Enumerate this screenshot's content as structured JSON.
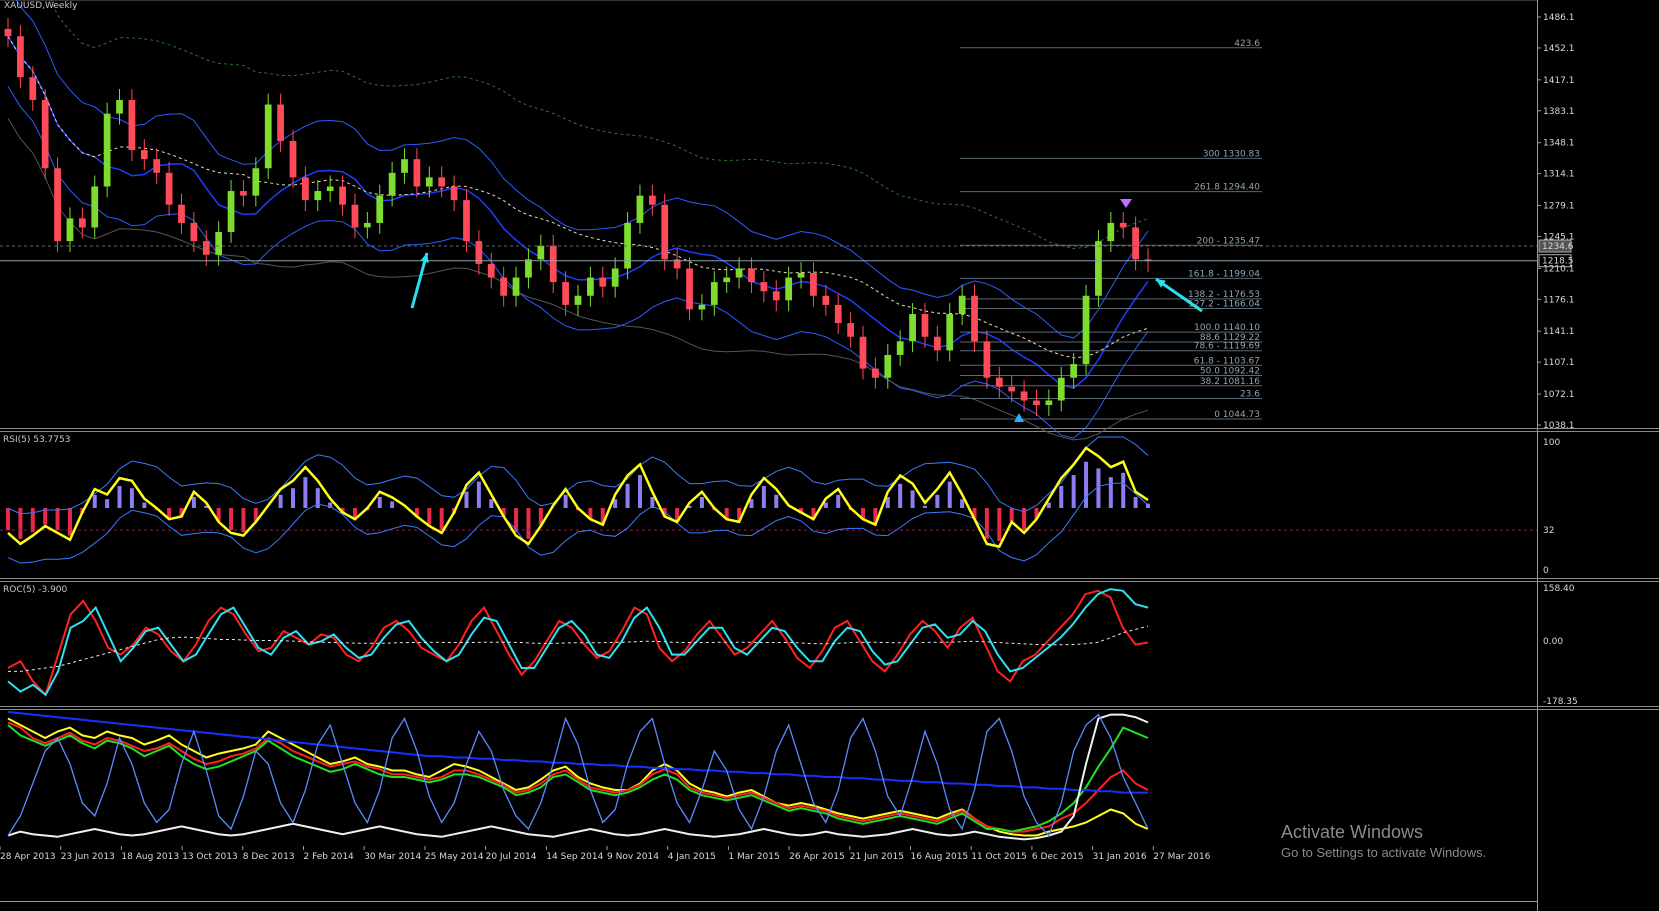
{
  "chart_data": [
    {
      "type": "candlestick",
      "title": "XAUUSD,Weekly",
      "y_ticks": [
        1486.1,
        1452.1,
        1417.1,
        1383.1,
        1348.1,
        1314.1,
        1279.1,
        1245.1,
        1210.1,
        1176.1,
        1141.1,
        1107.1,
        1072.1,
        1038.1
      ],
      "ylim": [
        1038.1,
        1486.1
      ],
      "price_tags": [
        1234.6,
        1218.5
      ],
      "x_labels": [
        "28 Apr 2013",
        "23 Jun 2013",
        "18 Aug 2013",
        "13 Oct 2013",
        "8 Dec 2013",
        "2 Feb 2014",
        "30 Mar 2014",
        "25 May 2014",
        "20 Jul 2014",
        "14 Sep 2014",
        "9 Nov 2014",
        "4 Jan 2015",
        "1 Mar 2015",
        "26 Apr 2015",
        "21 Jun 2015",
        "16 Aug 2015",
        "11 Oct 2015",
        "6 Dec 2015",
        "31 Jan 2016",
        "27 Mar 2016"
      ],
      "close_approx": [
        1465,
        1420,
        1395,
        1320,
        1240,
        1265,
        1255,
        1300,
        1380,
        1395,
        1340,
        1330,
        1315,
        1280,
        1260,
        1240,
        1225,
        1250,
        1295,
        1290,
        1320,
        1390,
        1350,
        1310,
        1285,
        1295,
        1300,
        1280,
        1255,
        1260,
        1290,
        1315,
        1330,
        1300,
        1310,
        1300,
        1285,
        1240,
        1215,
        1200,
        1180,
        1200,
        1220,
        1235,
        1195,
        1170,
        1180,
        1200,
        1190,
        1210,
        1260,
        1290,
        1280,
        1220,
        1210,
        1165,
        1170,
        1195,
        1200,
        1210,
        1195,
        1185,
        1175,
        1200,
        1205,
        1180,
        1170,
        1150,
        1135,
        1100,
        1090,
        1115,
        1130,
        1160,
        1135,
        1120,
        1160,
        1180,
        1130,
        1090,
        1080,
        1075,
        1065,
        1060,
        1065,
        1090,
        1105,
        1180,
        1240,
        1260,
        1255,
        1220,
        1218
      ],
      "fibonacci": [
        {
          "label": "423.6",
          "price": 1452.3
        },
        {
          "label": "300 1330.83",
          "price": 1330.83
        },
        {
          "label": "261.8 1294.40",
          "price": 1294.4
        },
        {
          "label": "200 - 1235.47",
          "price": 1235.47
        },
        {
          "label": "161.8 - 1199.04",
          "price": 1199.04
        },
        {
          "label": "138.2 - 1176.53",
          "price": 1176.53
        },
        {
          "label": "127.2 - 1166.04",
          "price": 1166.04
        },
        {
          "label": "100.0 1140.10",
          "price": 1140.1
        },
        {
          "label": "88.6 1129.22",
          "price": 1129.22
        },
        {
          "label": "78.6 - 1119.69",
          "price": 1119.69
        },
        {
          "label": "61.8 - 1103.67",
          "price": 1103.67
        },
        {
          "label": "50.0 1092.42",
          "price": 1092.42
        },
        {
          "label": "38.2 1081.16",
          "price": 1081.16
        },
        {
          "label": "23.6",
          "price": 1067.2
        },
        {
          "label": "0 1044.73",
          "price": 1044.73
        }
      ]
    },
    {
      "type": "line",
      "title": "RSI(5) 53.7753",
      "y_ticks": [
        100,
        32,
        0
      ],
      "ylim": [
        0,
        100
      ],
      "level": 32,
      "series": [
        {
          "values": [
            30,
            22,
            28,
            35,
            30,
            25,
            45,
            62,
            58,
            70,
            68,
            55,
            48,
            40,
            42,
            60,
            52,
            38,
            30,
            28,
            38,
            50,
            62,
            68,
            78,
            68,
            55,
            45,
            40,
            48,
            60,
            56,
            50,
            42,
            35,
            30,
            45,
            65,
            74,
            58,
            42,
            28,
            22,
            35,
            50,
            62,
            48,
            40,
            36,
            58,
            72,
            80,
            60,
            42,
            38,
            52,
            60,
            48,
            40,
            38,
            58,
            70,
            62,
            50,
            45,
            40,
            55,
            62,
            48,
            40,
            36,
            60,
            72,
            66,
            52,
            62,
            74,
            58,
            40,
            22,
            20,
            38,
            30,
            40,
            55,
            70,
            80,
            92,
            86,
            78,
            82,
            60,
            54
          ]
        }
      ]
    },
    {
      "type": "line",
      "title": "ROC(5) -3.900",
      "y_ticks": [
        158.4,
        0.0,
        -178.35
      ],
      "ylim": [
        -178.35,
        158.4
      ],
      "series": [
        {
          "values": [
            -80,
            -60,
            -120,
            -160,
            -40,
            80,
            120,
            60,
            -20,
            -40,
            -10,
            40,
            20,
            -30,
            -60,
            -10,
            60,
            100,
            80,
            20,
            -30,
            -20,
            30,
            10,
            -10,
            20,
            10,
            -40,
            -60,
            -20,
            40,
            60,
            30,
            -20,
            -40,
            -60,
            -10,
            60,
            100,
            30,
            -40,
            -100,
            -60,
            0,
            60,
            40,
            -10,
            -50,
            -30,
            30,
            100,
            80,
            -20,
            -60,
            -30,
            20,
            60,
            10,
            -40,
            -20,
            20,
            60,
            10,
            -50,
            -80,
            -30,
            40,
            60,
            0,
            -60,
            -90,
            -40,
            20,
            60,
            30,
            -20,
            40,
            70,
            -10,
            -90,
            -120,
            -60,
            -40,
            0,
            40,
            80,
            140,
            150,
            130,
            40,
            -10,
            -4
          ]
        },
        {
          "values": [
            -120,
            -150,
            -130,
            -160,
            -90,
            40,
            60,
            100,
            20,
            -60,
            -20,
            30,
            40,
            -10,
            -60,
            -40,
            20,
            80,
            100,
            40,
            -20,
            -40,
            10,
            30,
            -10,
            0,
            20,
            -20,
            -50,
            -40,
            10,
            50,
            60,
            10,
            -30,
            -60,
            -40,
            20,
            70,
            60,
            -10,
            -80,
            -80,
            -20,
            40,
            60,
            20,
            -40,
            -50,
            0,
            70,
            100,
            40,
            -40,
            -40,
            0,
            40,
            40,
            -20,
            -40,
            0,
            40,
            30,
            -20,
            -60,
            -60,
            0,
            40,
            30,
            -30,
            -70,
            -60,
            -10,
            40,
            50,
            10,
            20,
            60,
            30,
            -40,
            -90,
            -80,
            -50,
            -20,
            10,
            50,
            100,
            140,
            155,
            150,
            110,
            100
          ]
        },
        {
          "values": [
            -90,
            -90,
            -85,
            -80,
            -75,
            -65,
            -55,
            -45,
            -35,
            -25,
            -15,
            -5,
            5,
            10,
            12,
            10,
            8,
            5,
            5,
            3,
            2,
            2,
            1,
            0,
            -2,
            -3,
            -4,
            -5,
            -6,
            -6,
            -6,
            -5,
            -4,
            -4,
            -3,
            -4,
            -4,
            -4,
            -3,
            -3,
            -3,
            -4,
            -6,
            -7,
            -6,
            -5,
            -5,
            -5,
            -4,
            -3,
            -2,
            0,
            -1,
            -3,
            -4,
            -4,
            -4,
            -3,
            -3,
            -3,
            -4,
            -4,
            -4,
            -5,
            -7,
            -8,
            -7,
            -5,
            -3,
            -3,
            -4,
            -5,
            -5,
            -4,
            -3,
            -3,
            -2,
            0,
            -2,
            -4,
            -6,
            -8,
            -10,
            -11,
            -11,
            -10,
            -8,
            -3,
            10,
            25,
            35,
            45
          ]
        }
      ]
    },
    {
      "type": "line",
      "title": "",
      "ylim": [
        0,
        100
      ],
      "series": [
        {
          "values": [
            95,
            90,
            85,
            80,
            85,
            88,
            82,
            80,
            85,
            82,
            80,
            75,
            78,
            82,
            75,
            70,
            65,
            68,
            70,
            72,
            75,
            85,
            80,
            75,
            70,
            65,
            60,
            62,
            65,
            60,
            58,
            55,
            55,
            52,
            50,
            55,
            60,
            58,
            55,
            50,
            45,
            40,
            42,
            48,
            55,
            58,
            50,
            45,
            42,
            40,
            40,
            45,
            55,
            60,
            55,
            45,
            40,
            38,
            35,
            38,
            40,
            35,
            30,
            28,
            30,
            28,
            25,
            22,
            20,
            18,
            20,
            22,
            24,
            22,
            20,
            18,
            22,
            25,
            18,
            12,
            8,
            6,
            5,
            5,
            8,
            10,
            12,
            15,
            20,
            25,
            22,
            14,
            10
          ]
        },
        {
          "values": [
            92,
            88,
            80,
            76,
            80,
            84,
            78,
            75,
            80,
            78,
            74,
            70,
            72,
            76,
            70,
            64,
            60,
            62,
            66,
            68,
            72,
            80,
            76,
            70,
            66,
            62,
            58,
            60,
            62,
            58,
            56,
            52,
            52,
            50,
            48,
            50,
            55,
            55,
            52,
            48,
            44,
            38,
            40,
            45,
            52,
            55,
            48,
            42,
            40,
            38,
            40,
            44,
            52,
            56,
            52,
            42,
            38,
            36,
            34,
            36,
            38,
            34,
            30,
            26,
            28,
            26,
            24,
            20,
            18,
            16,
            18,
            20,
            22,
            20,
            18,
            16,
            20,
            24,
            18,
            12,
            10,
            8,
            8,
            10,
            12,
            18,
            22,
            30,
            40,
            50,
            55,
            45,
            40
          ]
        },
        {
          "values": [
            90,
            82,
            78,
            74,
            78,
            82,
            76,
            72,
            78,
            76,
            72,
            66,
            70,
            74,
            66,
            60,
            56,
            58,
            62,
            66,
            70,
            78,
            72,
            66,
            62,
            58,
            54,
            56,
            60,
            56,
            52,
            50,
            50,
            48,
            46,
            48,
            52,
            52,
            50,
            46,
            42,
            36,
            38,
            42,
            50,
            52,
            46,
            40,
            38,
            36,
            38,
            42,
            48,
            52,
            48,
            40,
            36,
            34,
            32,
            34,
            36,
            32,
            28,
            24,
            26,
            24,
            22,
            18,
            16,
            14,
            16,
            18,
            20,
            18,
            16,
            14,
            18,
            22,
            16,
            10,
            10,
            8,
            10,
            12,
            16,
            22,
            30,
            42,
            58,
            72,
            88,
            84,
            80
          ]
        },
        {
          "values": [
            100,
            99,
            98,
            97,
            96,
            95,
            94,
            93,
            92,
            91,
            90,
            89,
            88,
            87,
            86,
            85,
            84,
            83,
            82,
            81,
            80,
            79,
            78,
            77,
            76,
            75,
            74,
            73,
            72,
            71,
            70,
            69,
            68,
            67,
            66,
            66,
            65,
            65,
            64,
            64,
            63,
            63,
            62,
            62,
            61,
            61,
            60,
            60,
            59,
            59,
            58,
            58,
            57,
            57,
            56,
            56,
            55,
            55,
            54,
            54,
            53,
            53,
            52,
            52,
            51,
            51,
            50,
            50,
            49,
            49,
            48,
            48,
            47,
            47,
            46,
            46,
            45,
            45,
            44,
            44,
            43,
            43,
            42,
            42,
            41,
            41,
            40,
            40,
            39,
            39,
            38,
            38,
            38
          ]
        },
        {
          "values": [
            5,
            8,
            6,
            5,
            4,
            6,
            8,
            10,
            8,
            6,
            5,
            6,
            8,
            10,
            12,
            10,
            8,
            6,
            5,
            6,
            8,
            10,
            12,
            14,
            12,
            10,
            8,
            6,
            8,
            10,
            12,
            10,
            8,
            6,
            5,
            4,
            6,
            8,
            10,
            12,
            10,
            8,
            6,
            5,
            4,
            6,
            8,
            10,
            8,
            6,
            5,
            6,
            8,
            10,
            8,
            6,
            5,
            4,
            5,
            6,
            8,
            10,
            8,
            6,
            5,
            6,
            8,
            6,
            5,
            4,
            5,
            6,
            8,
            10,
            8,
            6,
            5,
            6,
            8,
            6,
            4,
            3,
            2,
            3,
            5,
            8,
            20,
            60,
            95,
            98,
            98,
            96,
            92
          ]
        },
        {
          "values": [
            5,
            20,
            45,
            70,
            80,
            60,
            30,
            20,
            45,
            80,
            60,
            30,
            15,
            25,
            60,
            85,
            55,
            20,
            10,
            35,
            70,
            60,
            30,
            15,
            40,
            75,
            90,
            60,
            30,
            15,
            40,
            80,
            95,
            70,
            35,
            15,
            30,
            60,
            85,
            70,
            40,
            20,
            10,
            30,
            60,
            95,
            75,
            40,
            15,
            25,
            60,
            85,
            95,
            60,
            30,
            15,
            40,
            70,
            55,
            25,
            10,
            35,
            70,
            90,
            60,
            30,
            15,
            40,
            80,
            95,
            70,
            35,
            20,
            50,
            85,
            60,
            25,
            10,
            40,
            85,
            95,
            70,
            35,
            15,
            5,
            30,
            70,
            90,
            98,
            80,
            50,
            30,
            10
          ]
        }
      ]
    }
  ],
  "watermark": {
    "title": "Activate Windows",
    "subtitle": "Go to Settings to activate Windows."
  }
}
